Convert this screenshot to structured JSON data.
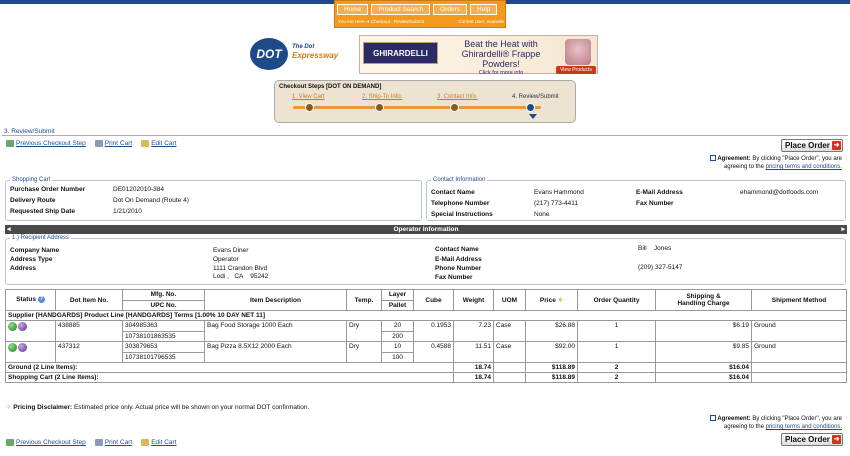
{
  "header": {
    "nav": [
      "Home",
      "Product Search",
      "Orders",
      "Help"
    ],
    "you_are_here": "You Are Here ➜ Checkout - Review/Submit",
    "current_user": "Current User: evanede"
  },
  "logo": {
    "mark": "DOT",
    "line1": "The Dot",
    "line2": "Expressway"
  },
  "banner": {
    "brand": "GHIRARDELLI",
    "line1": "Beat the Heat with",
    "line2": "Ghirardelli® Frappe Powders!",
    "line3": "Click for more info",
    "cta": "View Products"
  },
  "steps": {
    "title": "Checkout Steps [DOT ON DEMAND]",
    "items": [
      "1. View Cart",
      "2. Ship-To Info.",
      "3. Contact Info.",
      "4. Review/Submit"
    ]
  },
  "page_label": "3. Review/Submit",
  "actions": {
    "prev": "Previous Checkout Step",
    "print": "Print Cart",
    "edit": "Edit Cart",
    "place_order": "Place Order",
    "agreement_label": "Agreement:",
    "agreement_text": "By clicking \"Place Order\", you are agreeing to the",
    "agreement_link": "pricing terms and conditions."
  },
  "shopping_cart": {
    "legend": "Shopping Cart",
    "po_label": "Purchase Order Number",
    "po_value": "DE01202010-384",
    "route_label": "Delivery Route",
    "route_value": "Dot On Demand (Route 4)",
    "ship_label": "Requested Ship Date",
    "ship_value": "1/21/2010"
  },
  "contact": {
    "legend": "Contact Information",
    "name_label": "Contact Name",
    "name_value": "Evans Hammond",
    "phone_label": "Telephone Number",
    "phone_value": "(217) 773-4411",
    "instr_label": "Special Instructions",
    "instr_value": "None",
    "email_label": "E-Mail Address",
    "email_value": "ehammond@dotfoods.com",
    "fax_label": "Fax Number",
    "fax_value": ""
  },
  "operator": {
    "bar_title": "Operator Information",
    "legend": "1.) Recipient Address",
    "company_label": "Company Name",
    "company_value": "Evans Diner",
    "addrtype_label": "Address Type",
    "addrtype_value": "Operator",
    "address_label": "Address",
    "address_line1": "1111 Crandon Blvd",
    "address_line2": "Lodi ,   CA    95242",
    "contact_label": "Contact Name",
    "contact_value": "Bill    Jones",
    "email_label": "E-Mail Address",
    "email_value": "",
    "phone_label": "Phone Number",
    "phone_value": "(209) 327-5147",
    "fax_label": "Fax Number",
    "fax_value": ""
  },
  "table": {
    "headers": {
      "status": "Status",
      "dot_item": "Dot Item No.",
      "mfg": "Mfg. No.",
      "upc": "UPC No.",
      "desc": "Item Description",
      "temp": "Temp.",
      "layer": "Layer",
      "pallet": "Pallet",
      "cube": "Cube",
      "weight": "Weight",
      "uom": "UOM",
      "price": "Price",
      "qty": "Order Quantity",
      "ship1": "Shipping &",
      "ship2": "Handling Charge",
      "method": "Shipment Method"
    },
    "group_label": "Supplier [HANDGARDS] Product Line [HANDGARDS] Terms [1.00% 10 DAY NET 11]",
    "rows": [
      {
        "dot_item": "438885",
        "mfg": "304985363",
        "upc": "10738101863535",
        "desc": "Bag Food Storage 1000 Each",
        "temp": "Dry",
        "layer": "20",
        "pallet": "200",
        "cube": "0.1953",
        "weight": "7.23",
        "uom": "Case",
        "price": "$26.88",
        "qty": "1",
        "ship": "$6.19",
        "method": "Ground"
      },
      {
        "dot_item": "437312",
        "mfg": "303879653",
        "upc": "10738101796535",
        "desc": "Bag Pizza 8.5X12 2000 Each",
        "temp": "Dry",
        "layer": "10",
        "pallet": "100",
        "cube": "0.4588",
        "weight": "11.51",
        "uom": "Case",
        "price": "$92.00",
        "qty": "1",
        "ship": "$9.85",
        "method": "Ground"
      }
    ],
    "totals": [
      {
        "label": "Ground (2 Line Items):",
        "weight": "18.74",
        "price": "$118.89",
        "qty": "2",
        "ship": "$16.04"
      },
      {
        "label": "Shopping Cart (2 Line Items):",
        "weight": "18.74",
        "price": "$118.89",
        "qty": "2",
        "ship": "$16.04"
      }
    ]
  },
  "disclaimer": {
    "label": "Pricing Disclaimer:",
    "text": "Estimated price only. Actual price will be shown on your normal DOT confirmation."
  }
}
